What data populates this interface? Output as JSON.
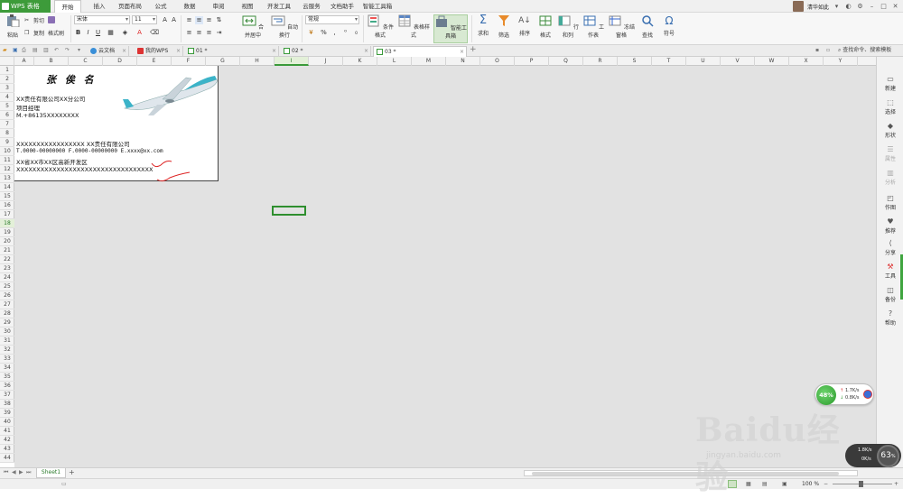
{
  "app": {
    "name": "WPS 表格"
  },
  "menu_tabs": [
    "开始",
    "插入",
    "页面布局",
    "公式",
    "数据",
    "审阅",
    "视图",
    "开发工具",
    "云服务",
    "文档助手",
    "智能工具箱"
  ],
  "user": {
    "name": "清华如此"
  },
  "ribbon": {
    "paste": "粘贴",
    "cut": "剪切",
    "copy": "复制",
    "format_painter": "格式刷",
    "font_name": "宋体",
    "font_size": "11",
    "merge_center": "合并居中",
    "wrap_text": "自动换行",
    "number_format": "常规",
    "cond_format": "条件格式",
    "table_style": "表格样式",
    "smart_toolbox": "智能工具箱",
    "sum": "求和",
    "filter": "筛选",
    "sort": "排序",
    "format": "格式",
    "row_col": "行和列",
    "worksheet": "工作表",
    "freeze": "冻结窗格",
    "find": "查找",
    "symbol": "符号"
  },
  "doc_tabs": [
    {
      "label": "云文档"
    },
    {
      "label": "我的WPS"
    },
    {
      "label": "01 *"
    },
    {
      "label": "02 *"
    },
    {
      "label": "03 *"
    }
  ],
  "search": {
    "placeholder": "查找命令、搜索模板"
  },
  "columns": [
    "A",
    "B",
    "C",
    "D",
    "E",
    "F",
    "G",
    "H",
    "I",
    "J",
    "K",
    "L",
    "M",
    "N",
    "O",
    "P",
    "Q",
    "R",
    "S",
    "T",
    "U",
    "V",
    "W",
    "X",
    "Y"
  ],
  "selected_column": "I",
  "rows": [
    "1",
    "2",
    "3",
    "4",
    "5",
    "6",
    "7",
    "8",
    "9",
    "10",
    "11",
    "12",
    "13",
    "14",
    "15",
    "16",
    "17",
    "18",
    "19",
    "20",
    "21",
    "22",
    "23",
    "24",
    "25",
    "26",
    "27",
    "28",
    "29",
    "30",
    "31",
    "32",
    "33",
    "34",
    "35",
    "36",
    "37",
    "38",
    "39",
    "40",
    "41",
    "42",
    "43",
    "44"
  ],
  "selected_row": "18",
  "card": {
    "name": "张 俟 名",
    "company": "XX责任有限公司XX分公司",
    "title": "项目经理",
    "mobile": "M.+86135XXXXXXXX",
    "company_line": "XXXXXXXXXXXXXXXXX XX责任有限公司",
    "contacts": "T.0000-00000000 F.0000-00000000 E.xxxx@xx.com",
    "address": "XX省XX市XX区高新开发区",
    "extra": "XXXXXXXXXXXXXXXXXXXXXXXXXXXXXXXXXX"
  },
  "sheet_tabs": [
    "Sheet1"
  ],
  "status": {
    "zoom": "100 %"
  },
  "right_panel": [
    "新建",
    "选择",
    "形状",
    "属性",
    "分析",
    "作图",
    "推荐",
    "分享",
    "工具",
    "备份",
    "帮助"
  ],
  "net_widget": {
    "percent": "48%",
    "up": "1.7K/s",
    "down": "0.8K/s"
  },
  "speed_widget": {
    "value": "63",
    "up": "1.8K/s",
    "down": "0K/s"
  },
  "watermark": {
    "text": "Baidu经验",
    "url": "jingyan.baidu.com"
  }
}
